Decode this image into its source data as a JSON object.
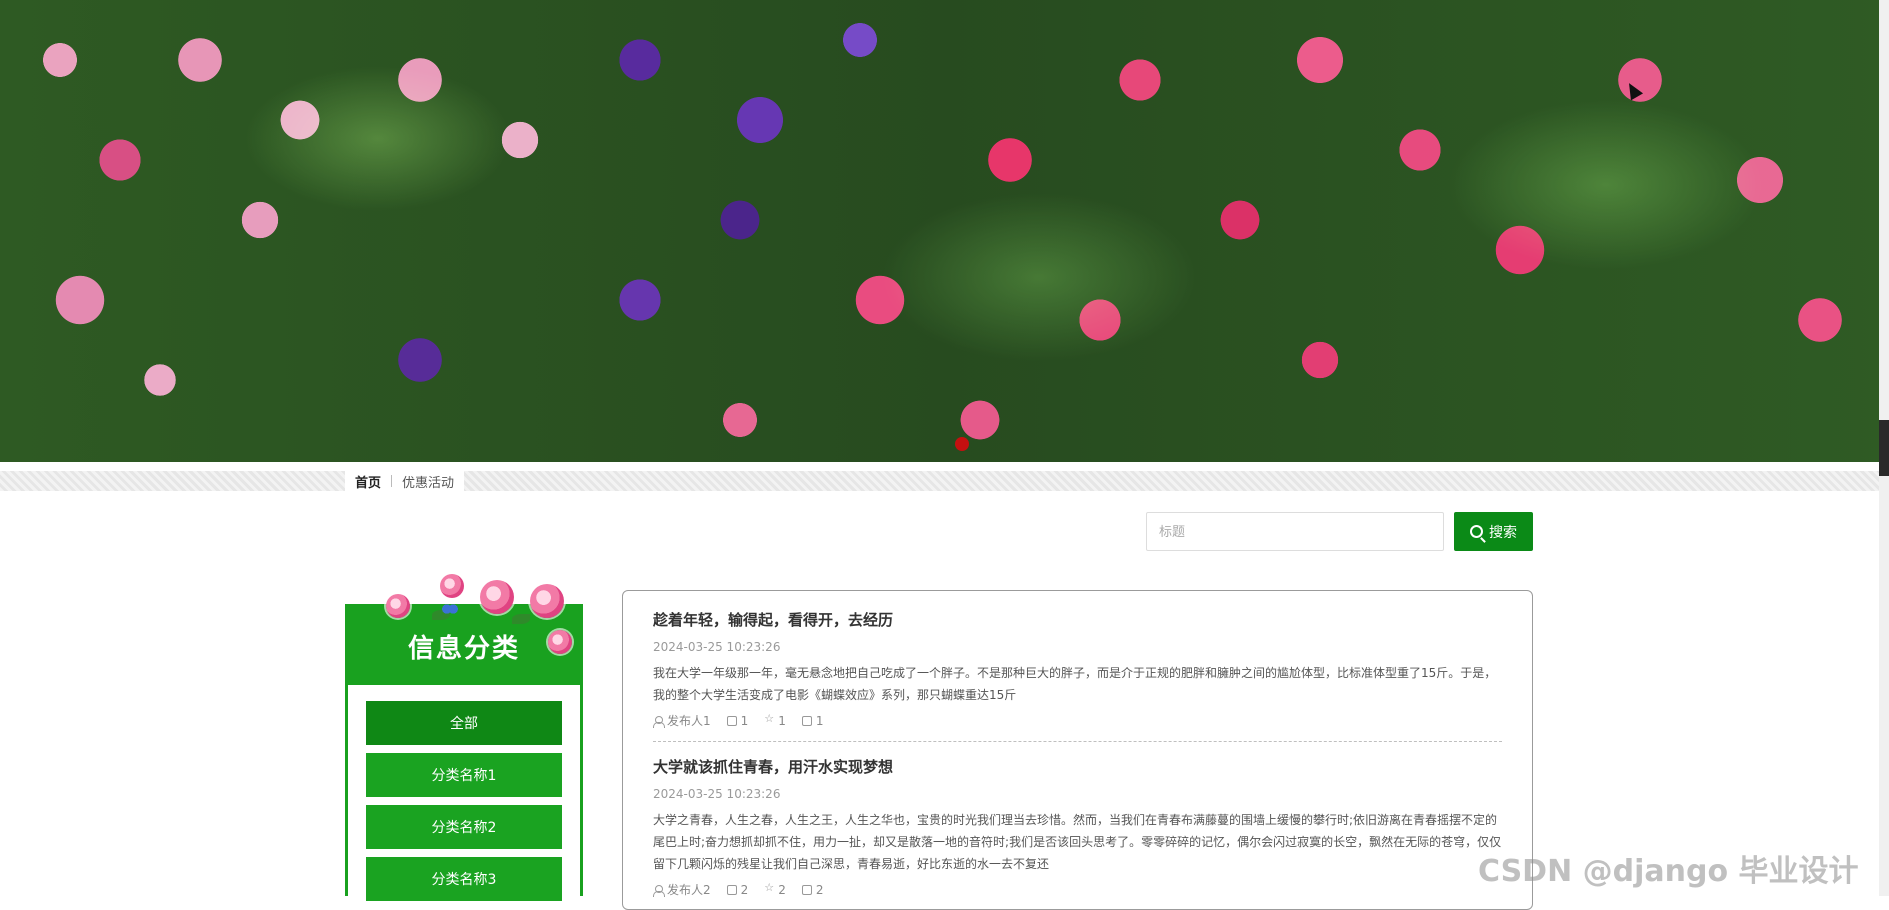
{
  "nav": {
    "items": [
      {
        "label": "首页",
        "active": true
      },
      {
        "label": "优惠活动",
        "active": false
      }
    ]
  },
  "search": {
    "placeholder": "标题",
    "value": "",
    "button_label": "搜索"
  },
  "sidebar": {
    "title": "信息分类",
    "categories": [
      {
        "label": "全部",
        "active": true
      },
      {
        "label": "分类名称1"
      },
      {
        "label": "分类名称2"
      },
      {
        "label": "分类名称3"
      }
    ]
  },
  "articles": [
    {
      "title": "趁着年轻，输得起，看得开，去经历",
      "date": "2024-03-25 10:23:26",
      "excerpt": "我在大学一年级那一年，毫无悬念地把自己吃成了一个胖子。不是那种巨大的胖子，而是介于正规的肥胖和臃肿之间的尴尬体型，比标准体型重了15斤。于是，我的整个大学生活变成了电影《蝴蝶效应》系列，那只蝴蝶重达15斤",
      "author": "发布人1",
      "likes": "1",
      "favorites": "1",
      "comments": "1"
    },
    {
      "title": "大学就该抓住青春，用汗水实现梦想",
      "date": "2024-03-25 10:23:26",
      "excerpt": "大学之青春，人生之春，人生之王，人生之华也，宝贵的时光我们理当去珍惜。然而，当我们在青春布满藤蔓的围墙上缓慢的攀行时;依旧游离在青春摇摆不定的尾巴上时;奋力想抓却抓不住，用力一扯，却又是散落一地的音符时;我们是否该回头思考了。零零碎碎的记忆，偶尔会闪过寂寞的长空，飘然在无际的苍穹，仅仅留下几颗闪烁的残星让我们自己深思，青春易逝，好比东逝的水一去不复还",
      "author": "发布人2",
      "likes": "2",
      "favorites": "2",
      "comments": "2"
    }
  ],
  "watermark": "CSDN @django 毕业设计",
  "colors": {
    "accent": "#19a11f",
    "accent_dark": "#0b8a17"
  }
}
